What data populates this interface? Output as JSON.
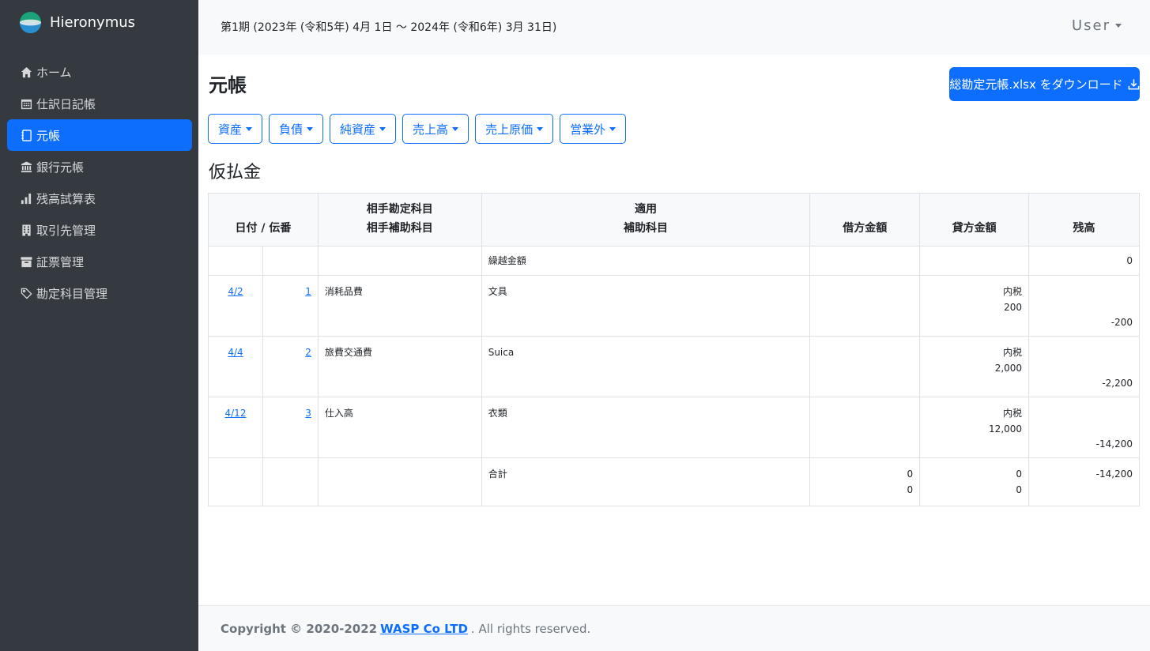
{
  "app": {
    "name": "Hieronymus"
  },
  "sidebar": {
    "items": [
      {
        "label": "ホーム",
        "icon": "home-icon"
      },
      {
        "label": "仕訳日記帳",
        "icon": "calendar-icon"
      },
      {
        "label": "元帳",
        "icon": "journal-icon",
        "active": true
      },
      {
        "label": "銀行元帳",
        "icon": "bank-icon"
      },
      {
        "label": "残高試算表",
        "icon": "bar-chart-icon"
      },
      {
        "label": "取引先管理",
        "icon": "building-icon"
      },
      {
        "label": "証票管理",
        "icon": "archive-icon"
      },
      {
        "label": "勘定科目管理",
        "icon": "tag-icon"
      }
    ]
  },
  "header": {
    "period": "第1期 (2023年 (令和5年) 4月 1日 〜 2024年 (令和6年) 3月 31日)",
    "user": "User"
  },
  "page": {
    "title": "元帳",
    "download_label": "総勘定元帳.xlsx をダウンロード",
    "categories": [
      "資産",
      "負債",
      "純資産",
      "売上高",
      "売上原価",
      "営業外"
    ],
    "account": "仮払金"
  },
  "table": {
    "headers": {
      "date_no": "日付 / 伝番",
      "counter_account": "相手勘定科目",
      "counter_sub": "相手補助科目",
      "summary": "適用",
      "sub_account": "補助科目",
      "debit": "借方金額",
      "credit": "貸方金額",
      "balance": "残高"
    },
    "opening": {
      "label": "繰越金額",
      "balance": "0"
    },
    "rows": [
      {
        "date": "4/2",
        "no": "1",
        "account": "消耗品費",
        "summary": "文具",
        "credit_note": "内税",
        "credit": "200",
        "balance": "-200"
      },
      {
        "date": "4/4",
        "no": "2",
        "account": "旅費交通費",
        "summary": "Suica",
        "credit_note": "内税",
        "credit": "2,000",
        "balance": "-2,200"
      },
      {
        "date": "4/12",
        "no": "3",
        "account": "仕入高",
        "summary": "衣類",
        "credit_note": "内税",
        "credit": "12,000",
        "balance": "-14,200"
      }
    ],
    "total": {
      "label": "合計",
      "debit1": "0",
      "debit2": "0",
      "credit1": "0",
      "credit2": "0",
      "balance": "-14,200"
    }
  },
  "footer": {
    "prefix": "Copyright © 2020-2022",
    "company": "WASP Co LTD",
    "suffix": ". All rights reserved."
  },
  "colors": {
    "sidebar": "#343a40",
    "accent": "#0d6efd",
    "topbar": "#f8f9fa"
  }
}
